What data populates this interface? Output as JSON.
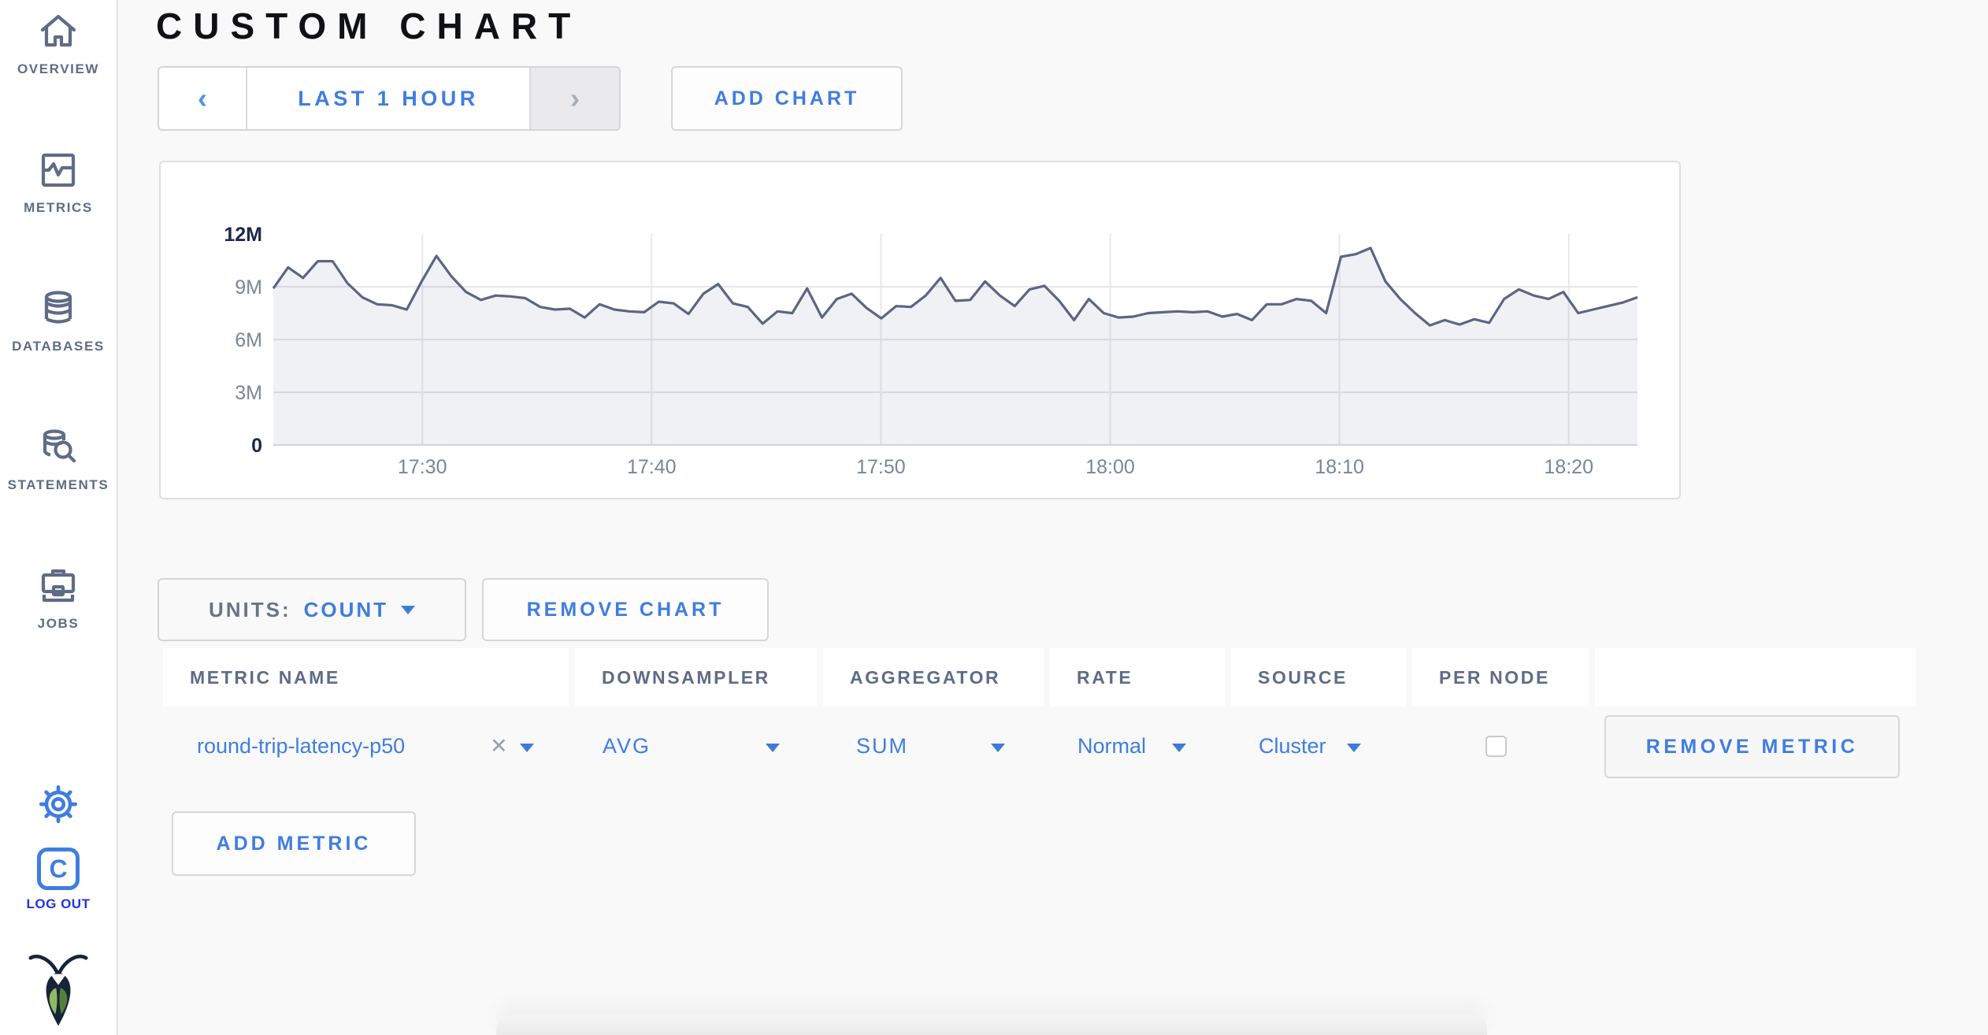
{
  "page": {
    "accent": "#3f7de0",
    "background": "#f9f9f9"
  },
  "sidebar": {
    "items": [
      {
        "label": "OVERVIEW",
        "icon": "home-icon"
      },
      {
        "label": "METRICS",
        "icon": "metrics-icon"
      },
      {
        "label": "DATABASES",
        "icon": "databases-icon"
      },
      {
        "label": "STATEMENTS",
        "icon": "statements-icon"
      },
      {
        "label": "JOBS",
        "icon": "jobs-icon"
      }
    ],
    "settings_icon": "gear-icon",
    "logo_letter": "C",
    "logout_label": "LOG OUT",
    "brand_icon": "cockroach-bug-icon"
  },
  "header": {
    "title": "CUSTOM CHART"
  },
  "time_selector": {
    "prev_icon": "‹",
    "label": "LAST 1 HOUR",
    "next_icon": "›"
  },
  "toolbar": {
    "add_chart_label": "ADD CHART"
  },
  "chart_controls": {
    "units_label": "UNITS:",
    "units_value": "COUNT",
    "remove_chart_label": "REMOVE CHART",
    "add_metric_label": "ADD METRIC"
  },
  "metrics_table": {
    "columns": [
      "METRIC NAME",
      "DOWNSAMPLER",
      "AGGREGATOR",
      "RATE",
      "SOURCE",
      "PER NODE",
      ""
    ],
    "row": {
      "metric_name": "round-trip-latency-p50",
      "clear_icon": "✕",
      "downsampler": "AVG",
      "aggregator": "SUM",
      "rate": "Normal",
      "source": "Cluster",
      "per_node_checked": false,
      "remove_metric_label": "REMOVE METRIC"
    }
  },
  "chart_data": {
    "type": "area",
    "title": "",
    "unit": "count",
    "legend": "none",
    "grid": true,
    "x_range": [
      "17:23.5",
      "18:23"
    ],
    "x_ticks": [
      "17:30",
      "17:40",
      "17:50",
      "18:00",
      "18:10",
      "18:20"
    ],
    "ylim_millions": [
      0,
      12
    ],
    "y_ticks": [
      {
        "label": "0",
        "value": 0,
        "emphasized": true,
        "gridline": false
      },
      {
        "label": "3M",
        "value": 3,
        "emphasized": false,
        "gridline": true
      },
      {
        "label": "6M",
        "value": 6,
        "emphasized": false,
        "gridline": true
      },
      {
        "label": "9M",
        "value": 9,
        "emphasized": false,
        "gridline": true
      },
      {
        "label": "12M",
        "value": 12,
        "emphasized": true,
        "gridline": false
      }
    ],
    "line_color": "#5c6584",
    "fill_color": "rgba(103,113,143,0.10)",
    "series": [
      {
        "name": "round-trip-latency-p50",
        "values_millions": [
          8.9,
          10.1,
          9.5,
          10.45,
          10.45,
          9.2,
          8.4,
          8.0,
          7.95,
          7.7,
          9.3,
          10.75,
          9.6,
          8.7,
          8.25,
          8.5,
          8.45,
          8.35,
          7.85,
          7.7,
          7.75,
          7.25,
          8.0,
          7.7,
          7.6,
          7.55,
          8.15,
          8.05,
          7.45,
          8.6,
          9.15,
          8.05,
          7.85,
          6.9,
          7.6,
          7.5,
          8.9,
          7.25,
          8.3,
          8.6,
          7.8,
          7.2,
          7.9,
          7.85,
          8.5,
          9.5,
          8.2,
          8.25,
          9.3,
          8.5,
          7.9,
          8.85,
          9.05,
          8.2,
          7.1,
          8.3,
          7.5,
          7.25,
          7.3,
          7.5,
          7.55,
          7.6,
          7.55,
          7.6,
          7.3,
          7.45,
          7.1,
          8.0,
          8.0,
          8.3,
          8.2,
          7.5,
          10.7,
          10.85,
          11.2,
          9.3,
          8.3,
          7.5,
          6.8,
          7.1,
          6.85,
          7.15,
          6.95,
          8.3,
          8.85,
          8.5,
          8.3,
          8.7,
          7.5,
          7.7,
          7.9,
          8.1,
          8.4
        ]
      }
    ]
  }
}
